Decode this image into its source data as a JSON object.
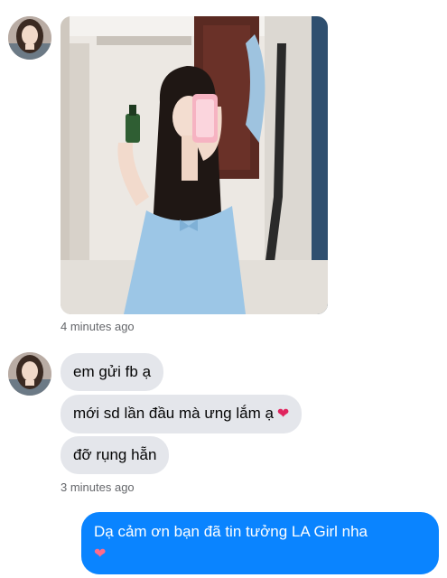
{
  "conversation": {
    "photo_timestamp": "4 minutes ago",
    "incoming_messages": [
      {
        "text": "em gửi fb ạ",
        "emoji": ""
      },
      {
        "text": "mới sd lần đầu mà ưng lắm ạ",
        "emoji": "❤"
      },
      {
        "text": "đỡ rụng hẵn",
        "emoji": ""
      }
    ],
    "messages_timestamp": "3 minutes ago",
    "outgoing_message": {
      "text": "Dạ cảm ơn bạn đã tin tưởng LA Girl nha",
      "emoji": "❤"
    }
  },
  "icons": {
    "sender_avatar": "avatar-icon",
    "heart": "heart-icon"
  },
  "colors": {
    "incoming_bubble": "#e4e6eb",
    "outgoing_bubble": "#0a84ff",
    "timestamp": "#65676b",
    "heart": "#e0245e"
  }
}
